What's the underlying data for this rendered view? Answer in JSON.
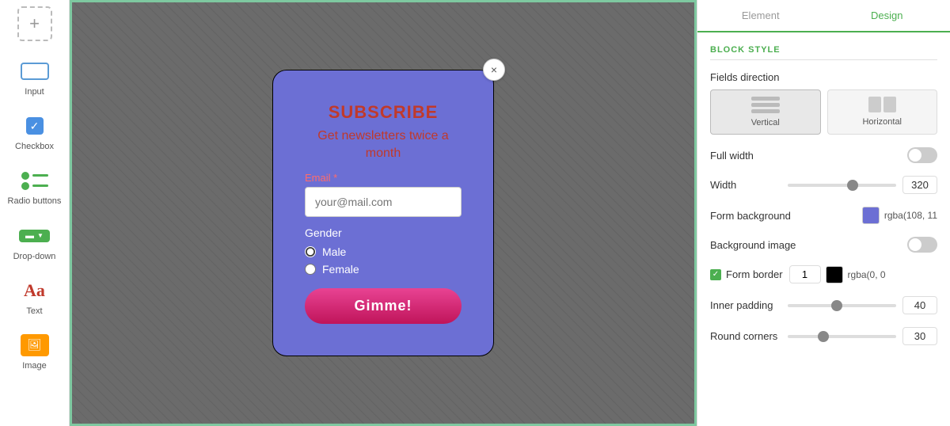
{
  "sidebar": {
    "add_label": "+",
    "items": [
      {
        "id": "input",
        "label": "Input",
        "icon": "input-icon"
      },
      {
        "id": "checkbox",
        "label": "Checkbox",
        "icon": "checkbox-icon"
      },
      {
        "id": "radio-buttons",
        "label": "Radio buttons",
        "icon": "radio-icon"
      },
      {
        "id": "drop-down",
        "label": "Drop-down",
        "icon": "dropdown-icon"
      },
      {
        "id": "text",
        "label": "Text",
        "icon": "text-icon"
      },
      {
        "id": "image",
        "label": "Image",
        "icon": "image-icon"
      }
    ]
  },
  "form": {
    "close_icon": "×",
    "title": "SUBSCRIBE",
    "subtitle": "Get newsletters twice a month",
    "email_label": "Email",
    "email_required": "*",
    "email_placeholder": "your@mail.com",
    "gender_label": "Gender",
    "gender_options": [
      "Male",
      "Female"
    ],
    "submit_label": "Gimme!"
  },
  "right_panel": {
    "tabs": [
      {
        "id": "element",
        "label": "Element"
      },
      {
        "id": "design",
        "label": "Design"
      }
    ],
    "active_tab": "design",
    "section_title": "BLOCK STYLE",
    "fields_direction_label": "Fields direction",
    "direction_options": [
      {
        "id": "vertical",
        "label": "Vertical"
      },
      {
        "id": "horizontal",
        "label": "Horizontal"
      }
    ],
    "active_direction": "vertical",
    "full_width_label": "Full width",
    "full_width_on": false,
    "width_label": "Width",
    "width_value": "320",
    "width_slider_pos": "60",
    "form_background_label": "Form background",
    "form_background_color": "#6c6fd4",
    "form_background_value": "rgba(108, 11",
    "background_image_label": "Background image",
    "background_image_on": false,
    "form_border_label": "Form border",
    "form_border_checked": true,
    "form_border_width": "1",
    "form_border_color": "#000000",
    "form_border_color_value": "rgba(0, 0",
    "inner_padding_label": "Inner padding",
    "inner_padding_value": "40",
    "inner_padding_slider_pos": "50",
    "round_corners_label": "Round corners",
    "round_corners_value": "30",
    "round_corners_slider_pos": "35"
  }
}
